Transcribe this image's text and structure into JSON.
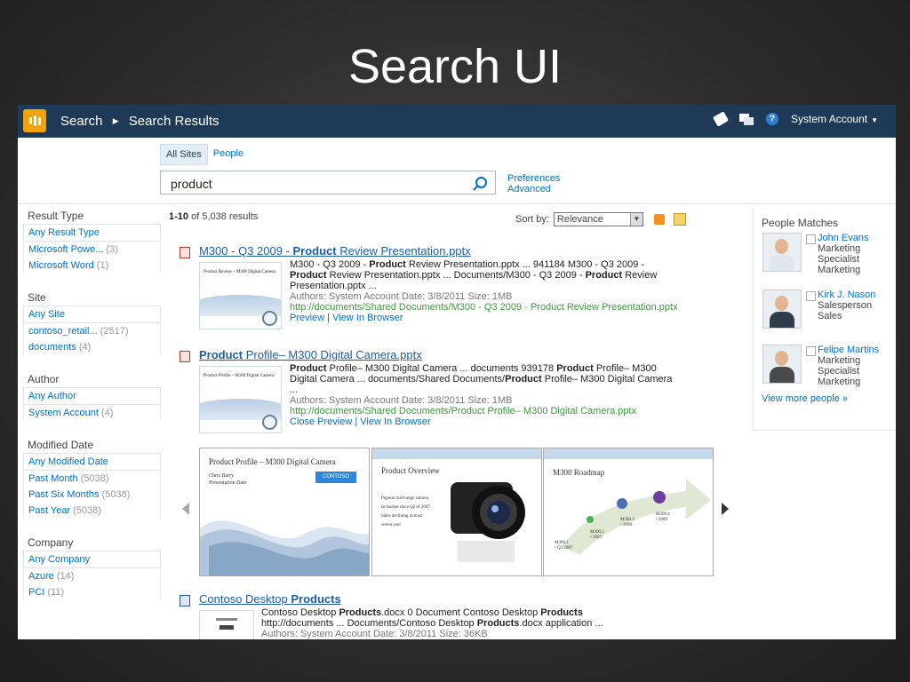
{
  "slide_title": "Search UI",
  "topbar": {
    "crumb_root": "Search",
    "crumb_current": "Search Results",
    "account": "System Account"
  },
  "scope_tabs": [
    "All Sites",
    "People"
  ],
  "search": {
    "value": "product"
  },
  "preferences": {
    "preferences": "Preferences",
    "advanced": "Advanced"
  },
  "summary": {
    "range": "1-10",
    "text": "of 5,038 results"
  },
  "sort": {
    "label": "Sort by:",
    "value": "Relevance"
  },
  "refiners": [
    {
      "heading": "Result Type",
      "any": "Any Result Type",
      "items": [
        {
          "label": "Microsoft Powe...",
          "count": "(3)"
        },
        {
          "label": "Microsoft Word",
          "count": "(1)"
        }
      ]
    },
    {
      "heading": "Site",
      "any": "Any Site",
      "items": [
        {
          "label": "contoso_retail...",
          "count": "(2517)"
        },
        {
          "label": "documents",
          "count": "(4)"
        }
      ]
    },
    {
      "heading": "Author",
      "any": "Any Author",
      "items": [
        {
          "label": "System Account",
          "count": "(4)"
        }
      ]
    },
    {
      "heading": "Modified Date",
      "any": "Any Modified Date",
      "items": [
        {
          "label": "Past Month",
          "count": "(5038)"
        },
        {
          "label": "Past Six Months",
          "count": "(5038)"
        },
        {
          "label": "Past Year",
          "count": "(5038)"
        }
      ]
    },
    {
      "heading": "Company",
      "any": "Any Company",
      "items": [
        {
          "label": "Azure",
          "count": "(14)"
        },
        {
          "label": "PCI",
          "count": "(11)"
        }
      ]
    }
  ],
  "results": [
    {
      "title_pre": "M300 - Q3 2009 - ",
      "title_bold": "Product",
      "title_post": " Review Presentation.pptx",
      "s1a": "M300 - Q3 2009 - ",
      "s1b": "Product",
      "s1c": " Review Presentation.pptx ... 941184 M300 - Q3 2009 - ",
      "s1d": "Product",
      "s1e": " Review Presentation.pptx ... Documents/M300 - Q3 2009 - ",
      "s1f": "Product",
      "s1g": " Review Presentation.pptx ...",
      "meta": "Authors: System Account   Date: 3/8/2011   Size: 1MB",
      "url": "http://documents/Shared Documents/M300 - Q3 2009 - Product Review Presentation.pptx",
      "link1": "Preview",
      "link2": "View In Browser",
      "thumb_title": "Product Review – M300 Digital Camera"
    },
    {
      "title_bold": "Product",
      "title_post": " Profile– M300 Digital Camera.pptx",
      "s1b": "Product",
      "s1c": " Profile– M300 Digital Camera ... documents 939178 ",
      "s1d": "Product",
      "s1e": " Profile– M300 Digital Camera ... documents/Shared Documents/",
      "s1f": "Product",
      "s1g": " Profile– M300 Digital Camera ...",
      "meta": "Authors: System Account   Date: 3/8/2011   Size: 1MB",
      "url": "http://documents/Shared Documents/Product Profile– M300 Digital Camera.pptx",
      "link1": "Close Preview",
      "link2": "View In Browser",
      "thumb_title": "Product Profile – M300 Digital Camera"
    },
    {
      "title_pre": "Contoso Desktop ",
      "title_bold": "Products",
      "s1a": "Contoso Desktop ",
      "s1b": "Products",
      "s1c": ".docx 0 Document Contoso Desktop ",
      "s1d": "Products",
      "s2a": "http://documents ... Documents/Contoso Desktop ",
      "s2b": "Products",
      "s2c": ".docx application ...",
      "meta": "Authors: System Account   Date: 3/8/2011   Size: 36KB"
    }
  ],
  "carousel": {
    "slide1": {
      "title": "Product Profile – M300 Digital Camera",
      "sub1": "Chris Barry",
      "sub2": "Presentation Date",
      "badge": "CONTOSO"
    },
    "slide2": {
      "title": "Product Overview",
      "b1": "Popular mid-range camera",
      "b2": "In market since Q2 of 2007",
      "b3": "Sales declining in most",
      "b4": "recent year"
    },
    "slide3": {
      "title": "M300 Roadmap",
      "l1": "M300.1",
      "l1b": "• Q3 2007",
      "l2": "M300.2",
      "l2b": "• 2007",
      "l3": "M300.3",
      "l3b": "• 2008",
      "l4": "M300.4",
      "l4b": "• 2009"
    }
  },
  "people": {
    "heading": "People Matches",
    "list": [
      {
        "name": "John Evans",
        "line2": "Marketing",
        "line3": "Specialist",
        "line4": "Marketing"
      },
      {
        "name": "Kirk J. Nason",
        "line2": "Salesperson",
        "line3": "Sales",
        "line4": ""
      },
      {
        "name": "Felipe Martins",
        "line2": "Marketing",
        "line3": "Specialist",
        "line4": "Marketing"
      }
    ],
    "more": "View more people »"
  },
  "colors": {
    "topbar": "#1f3a56",
    "link": "#0072c6",
    "url": "#3c9b3c",
    "logo": "#f0a30a"
  }
}
